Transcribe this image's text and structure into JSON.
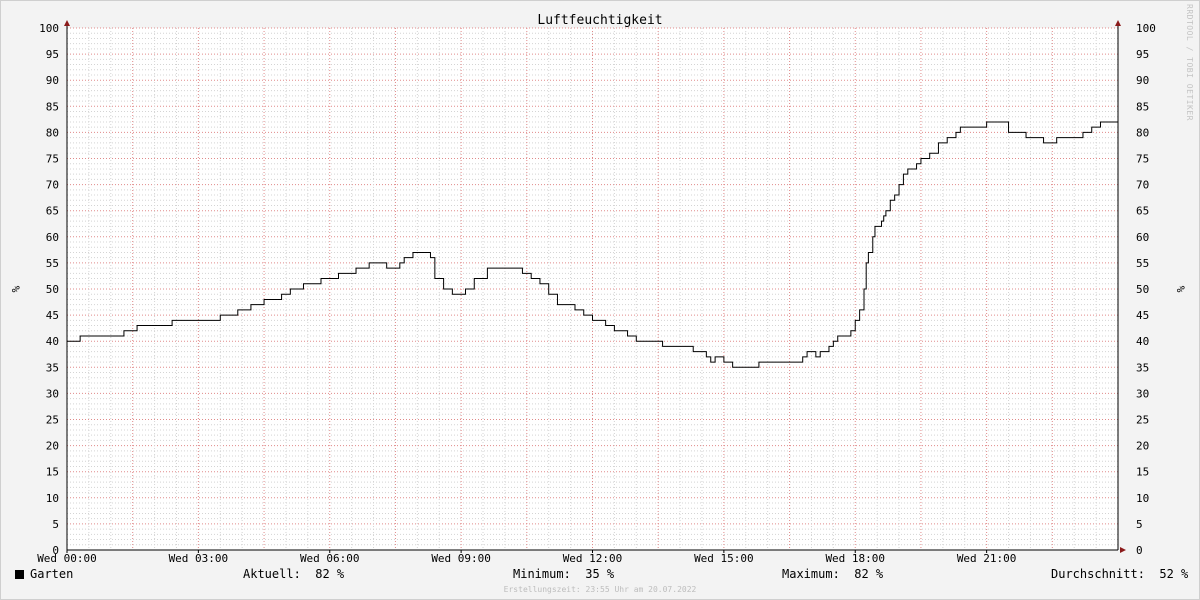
{
  "chart_data": {
    "type": "line",
    "title": "Luftfeuchtigkeit",
    "ylabel": "%",
    "ylim": [
      0,
      100
    ],
    "y_ticks": [
      "0",
      "5",
      "10",
      "15",
      "20",
      "25",
      "30",
      "35",
      "40",
      "45",
      "50",
      "55",
      "60",
      "65",
      "70",
      "75",
      "80",
      "85",
      "90",
      "95",
      "100"
    ],
    "x_range_hours": [
      0,
      24
    ],
    "x_ticks": [
      {
        "h": 0,
        "label": "Wed 00:00"
      },
      {
        "h": 3,
        "label": "Wed 03:00"
      },
      {
        "h": 6,
        "label": "Wed 06:00"
      },
      {
        "h": 9,
        "label": "Wed 09:00"
      },
      {
        "h": 12,
        "label": "Wed 12:00"
      },
      {
        "h": 15,
        "label": "Wed 15:00"
      },
      {
        "h": 18,
        "label": "Wed 18:00"
      },
      {
        "h": 21,
        "label": "Wed 21:00"
      }
    ],
    "grid": true,
    "legend_position": "bottom-left",
    "series": [
      {
        "name": "Garten",
        "color": "#000000",
        "x": [
          0,
          0.3,
          0.8,
          1.3,
          1.6,
          2.4,
          2.6,
          3.0,
          3.5,
          3.9,
          4.2,
          4.5,
          4.9,
          5.1,
          5.4,
          5.8,
          6.1,
          6.2,
          6.6,
          6.9,
          7.0,
          7.3,
          7.6,
          7.7,
          7.8,
          7.9,
          8.0,
          8.1,
          8.3,
          8.4,
          8.6,
          8.8,
          8.95,
          9.1,
          9.3,
          9.6,
          9.8,
          10.0,
          10.2,
          10.4,
          10.6,
          10.8,
          11.0,
          11.2,
          11.4,
          11.6,
          11.8,
          12.0,
          12.3,
          12.5,
          12.8,
          13.0,
          13.6,
          14.3,
          14.5,
          14.6,
          14.7,
          14.8,
          15.0,
          15.2,
          15.5,
          15.8,
          16.1,
          16.7,
          16.8,
          16.9,
          17.0,
          17.1,
          17.2,
          17.4,
          17.5,
          17.6,
          17.7,
          17.9,
          18.0,
          18.1,
          18.2,
          18.25,
          18.3,
          18.4,
          18.45,
          18.5,
          18.6,
          18.65,
          18.7,
          18.8,
          18.9,
          19.0,
          19.1,
          19.2,
          19.3,
          19.4,
          19.5,
          19.6,
          19.7,
          19.9,
          20.1,
          20.2,
          20.3,
          20.4,
          20.5,
          20.8,
          21.0,
          21.2,
          21.5,
          21.9,
          22.3,
          22.6,
          22.8,
          22.9,
          23.0,
          23.2,
          23.4,
          23.6,
          23.7,
          24.0
        ],
        "values": [
          40,
          41,
          41,
          42,
          43,
          44,
          44,
          44,
          45,
          46,
          47,
          48,
          49,
          50,
          51,
          52,
          52,
          53,
          54,
          55,
          55,
          54,
          55,
          56,
          56,
          57,
          57,
          57,
          56,
          52,
          50,
          49,
          49,
          50,
          52,
          54,
          54,
          54,
          54,
          53,
          52,
          51,
          49,
          47,
          47,
          46,
          45,
          44,
          43,
          42,
          41,
          40,
          39,
          38,
          38,
          37,
          36,
          37,
          36,
          35,
          35,
          36,
          36,
          36,
          37,
          38,
          38,
          37,
          38,
          39,
          40,
          41,
          41,
          42,
          44,
          46,
          50,
          55,
          57,
          60,
          62,
          62,
          63,
          64,
          65,
          67,
          68,
          70,
          72,
          73,
          73,
          74,
          75,
          75,
          76,
          78,
          79,
          79,
          80,
          81,
          81,
          81,
          82,
          82,
          80,
          79,
          78,
          79,
          79,
          79,
          79,
          80,
          81,
          82,
          82,
          82
        ]
      }
    ]
  },
  "legend": {
    "series_name": "Garten",
    "stats": [
      {
        "label": "Aktuell:",
        "value": "82 %"
      },
      {
        "label": "Minimum:",
        "value": "35 %"
      },
      {
        "label": "Maximum:",
        "value": "82 %"
      },
      {
        "label": "Durchschnitt:",
        "value": "52 %"
      }
    ]
  },
  "credit": "RRDTOOL / TOBI OETIKER",
  "footer": "Erstellungszeit: 23:55 Uhr am 20.07.2022"
}
